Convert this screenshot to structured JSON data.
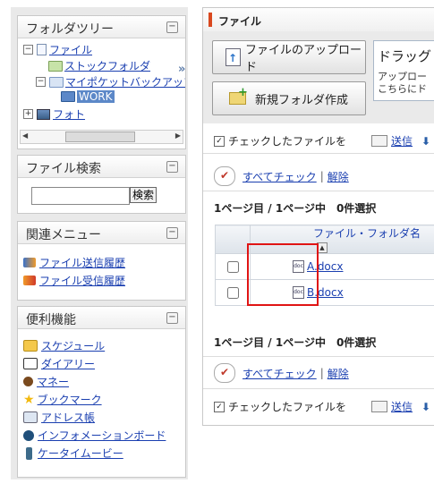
{
  "tree": {
    "title": "フォルダツリー",
    "items": [
      "ファイル",
      "ストックフォルダ",
      "マイポケットバックアップ",
      "WORK",
      "フォト"
    ]
  },
  "search": {
    "title": "ファイル検索",
    "value": "",
    "button": "検索"
  },
  "related": {
    "title": "関連メニュー",
    "items": [
      "ファイル送信履歴",
      "ファイル受信履歴"
    ]
  },
  "tools": {
    "title": "便利機能",
    "items": [
      "スケジュール",
      "ダイアリー",
      "マネー",
      "ブックマーク",
      "アドレス帳",
      "インフォメーションボード",
      "ケータイムービー"
    ]
  },
  "main": {
    "title": "ファイル",
    "upload_label": "ファイルのアップロード",
    "newfolder_label": "新規フォルダ作成",
    "drop_title": "ドラッグ",
    "drop_text_1": "アップロー",
    "drop_text_2": "こちらにド",
    "checked_label": "チェックしたファイルを",
    "send_label": "送信",
    "check_all": "すべてチェック",
    "release": "解除",
    "separator": "|",
    "page_info": "1ページ目 / 1ページ中　0件選択",
    "column_header": "ファイル・フォルダ名",
    "files": [
      "A.docx",
      "B.docx"
    ]
  },
  "colors": {
    "accent": "#d9481f",
    "link": "#1a3fb0",
    "highlight": "#e01414"
  }
}
